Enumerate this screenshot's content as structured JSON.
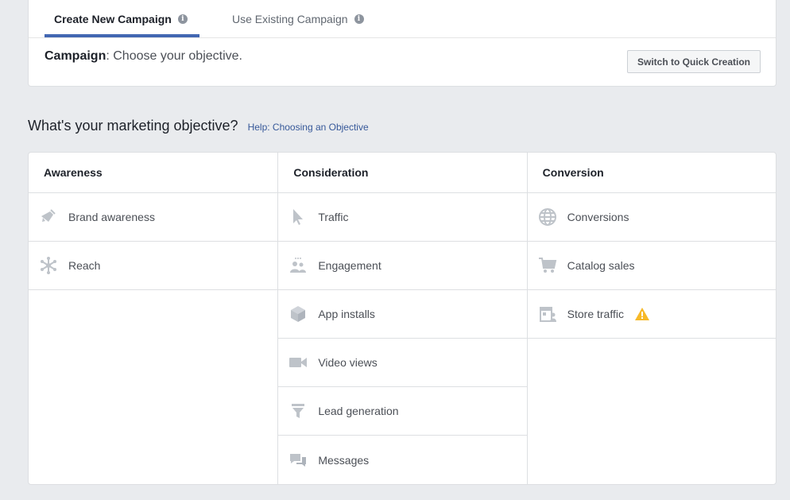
{
  "tabs": {
    "create": "Create New Campaign",
    "existing": "Use Existing Campaign"
  },
  "campaign": {
    "label": "Campaign",
    "text": ": Choose your objective.",
    "quick_button": "Switch to Quick Creation"
  },
  "objective": {
    "title": "What's your marketing objective?",
    "help": "Help: Choosing an Objective"
  },
  "columns": {
    "awareness": {
      "header": "Awareness",
      "items": [
        {
          "label": "Brand awareness",
          "icon": "megaphone-icon"
        },
        {
          "label": "Reach",
          "icon": "reach-icon"
        }
      ]
    },
    "consideration": {
      "header": "Consideration",
      "items": [
        {
          "label": "Traffic",
          "icon": "cursor-icon"
        },
        {
          "label": "Engagement",
          "icon": "people-icon"
        },
        {
          "label": "App installs",
          "icon": "box-icon"
        },
        {
          "label": "Video views",
          "icon": "video-camera-icon"
        },
        {
          "label": "Lead generation",
          "icon": "funnel-icon"
        },
        {
          "label": "Messages",
          "icon": "chat-bubbles-icon"
        }
      ]
    },
    "conversion": {
      "header": "Conversion",
      "items": [
        {
          "label": "Conversions",
          "icon": "globe-icon"
        },
        {
          "label": "Catalog sales",
          "icon": "shopping-cart-icon"
        },
        {
          "label": "Store traffic",
          "icon": "store-icon"
        }
      ]
    }
  },
  "colors": {
    "accent": "#4267b2",
    "link": "#365899",
    "icon": "#bec3c9",
    "warning": "#f7b928"
  }
}
